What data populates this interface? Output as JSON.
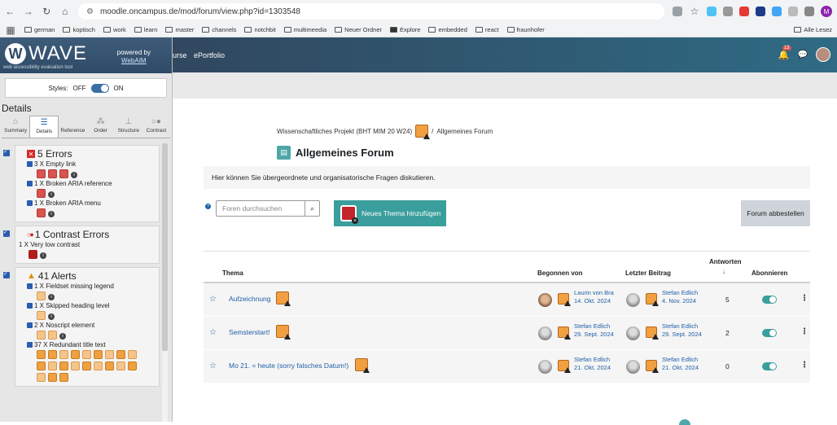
{
  "browser": {
    "url": "moodle.oncampus.de/mod/forum/view.php?id=1303548",
    "profile_initial": "M",
    "bookmarks": [
      "german",
      "koptisch",
      "work",
      "learn",
      "master",
      "channels",
      "notchbit",
      "multimeedia",
      "Neuer Ordner",
      "Explore",
      "embedded",
      "react",
      "fraunhofer"
    ],
    "reading_list": "Alle Lesez"
  },
  "wave": {
    "logo_text": "WAVE",
    "subtitle": "web accessibility evaluation tool",
    "powered_by": "powered by",
    "webaim": "WebAIM",
    "styles_label": "Styles:",
    "styles_off": "OFF",
    "styles_on": "ON",
    "details_heading": "Details",
    "tabs": [
      "Summary",
      "Details",
      "Reference",
      "Order",
      "Structure",
      "Contrast"
    ],
    "errors": {
      "title": "5 Errors",
      "items": [
        "3 X Empty link",
        "1 X Broken ARIA reference",
        "1 X Broken ARIA menu"
      ]
    },
    "contrast": {
      "title": "1 Contrast Errors",
      "items": [
        "1 X Very low contrast"
      ]
    },
    "alerts": {
      "title": "41 Alerts",
      "items": [
        "1 X Fieldset missing legend",
        "1 X Skipped heading level",
        "2 X Noscript element",
        "37 X Redundant title text"
      ]
    }
  },
  "moodle": {
    "nav_items": [
      "urse",
      "ePortfolio"
    ],
    "notification_count": "13",
    "breadcrumb_course": "Wissenschaftliches Projekt (BHT MIM 20 W24)",
    "breadcrumb_sep": "/",
    "breadcrumb_current": "Allgemeines Forum",
    "page_title": "Allgemeines Forum",
    "description": "Hier können Sie übergeordnete und organisatorische Fragen diskutieren.",
    "search_placeholder": "Foren durchsuchen",
    "new_topic_label": "Neues Thema hinzufügen",
    "unsubscribe_label": "Forum abbestellen",
    "table": {
      "headers": {
        "topic": "Thema",
        "started_by": "Begonnen von",
        "last_post": "Letzter Beitrag",
        "replies": "Antworten",
        "sort_arrow": "↓",
        "subscribe": "Abonnieren"
      },
      "rows": [
        {
          "topic": "Aufzeichnung",
          "started_name": "Laurin von Bra",
          "started_date": "14. Okt. 2024",
          "last_name": "Stefan Edlich",
          "last_date": "4. Nov. 2024",
          "replies": "5"
        },
        {
          "topic": "Semsterstart!",
          "started_name": "Stefan Edlich",
          "started_date": "29. Sept. 2024",
          "last_name": "Stefan Edlich",
          "last_date": "29. Sept. 2024",
          "replies": "2"
        },
        {
          "topic": "Mo 21. = heute (sorry falsches Datum!)",
          "started_name": "Stefan Edlich",
          "started_date": "21. Okt. 2024",
          "last_name": "Stefan Edlich",
          "last_date": "21. Okt. 2024",
          "replies": "0"
        }
      ]
    }
  }
}
